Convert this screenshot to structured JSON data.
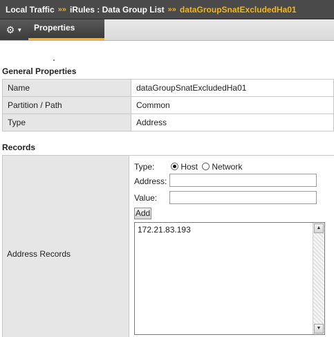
{
  "breadcrumb": {
    "section": "Local Traffic",
    "sep": "»»",
    "path": "iRules : Data Group List",
    "current": "dataGroupSnatExcludedHa01"
  },
  "tabs": {
    "menu_icon": "gear-icon",
    "active": "Properties"
  },
  "general": {
    "title": "General Properties",
    "rows": [
      {
        "label": "Name",
        "value": "dataGroupSnatExcludedHa01"
      },
      {
        "label": "Partition / Path",
        "value": "Common"
      },
      {
        "label": "Type",
        "value": "Address"
      }
    ]
  },
  "records": {
    "title": "Records",
    "label": "Address Records",
    "type_label": "Type:",
    "type_options": [
      {
        "label": "Host",
        "selected": true
      },
      {
        "label": "Network",
        "selected": false
      }
    ],
    "address_label": "Address:",
    "address_value": "",
    "value_label": "Value:",
    "value_value": "",
    "add_label": "Add",
    "list": [
      "172.21.83.193"
    ]
  },
  "colors": {
    "accent": "#f1b521",
    "bar": "#4a4a4a"
  }
}
